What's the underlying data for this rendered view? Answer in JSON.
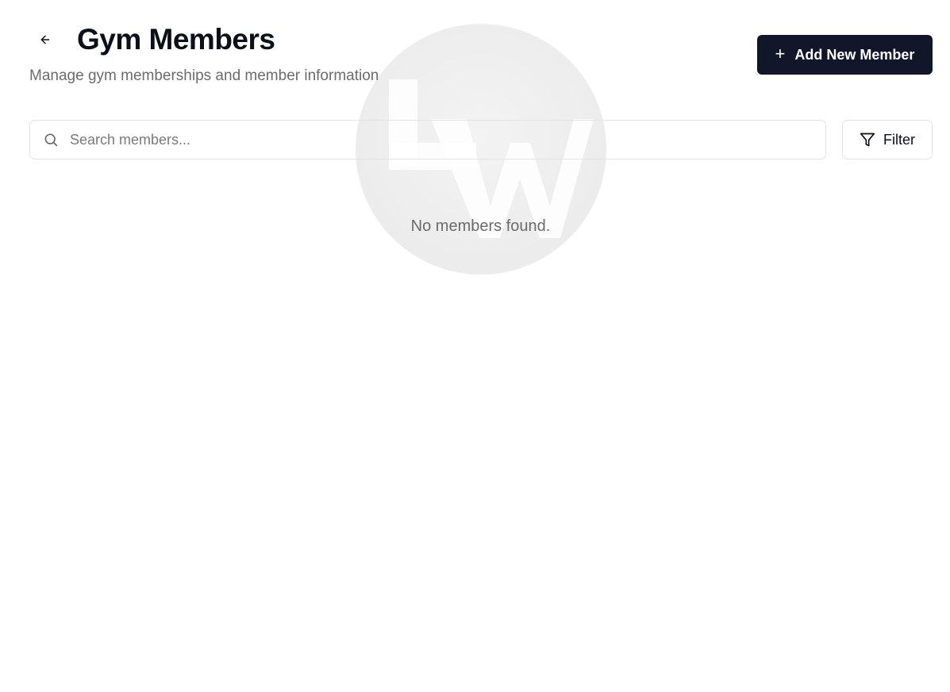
{
  "header": {
    "title": "Gym Members",
    "subtitle": "Manage gym memberships and member information",
    "back_icon": "arrow-left-icon"
  },
  "actions": {
    "add_label": "Add New Member",
    "add_icon": "plus-icon"
  },
  "search": {
    "placeholder": "Search members...",
    "value": "",
    "icon": "search-icon"
  },
  "filter": {
    "label": "Filter",
    "icon": "filter-icon"
  },
  "list": {
    "empty_message": "No members found."
  },
  "colors": {
    "primary_button": "#111729",
    "muted_text": "#6b6b6b",
    "border": "#e3e3e3"
  }
}
